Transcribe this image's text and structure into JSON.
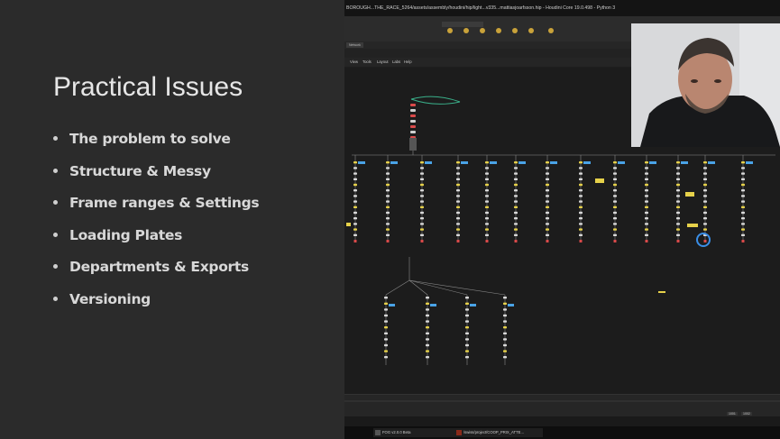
{
  "slide": {
    "title": "Practical Issues",
    "bullets": [
      "The problem to solve",
      "Structure & Messy",
      "Frame ranges & Settings",
      "Loading Plates",
      "Departments & Exports",
      "Versioning"
    ]
  },
  "app": {
    "window_title": "BOROUGH...THE_RACE_5264/assets/assembly/houdini/hip/light...v335...mattiasjoarfsson.hip - Houdini Core 19.0.498 - Python 3",
    "pane_tab": "Network",
    "menu": [
      "View",
      "Tools",
      "Layout",
      "Labs",
      "Help"
    ],
    "timeline": {
      "frame_in": "1001",
      "frame_out": "1002"
    },
    "taskbar": [
      {
        "label": "FOG v2.0.0 Beta"
      },
      {
        "label": "/swiss/project/COOP_PRIX_ATTE..."
      }
    ]
  },
  "colors": {
    "slide_bg": "#2b2b2b",
    "slide_text": "#e6e6e6",
    "network_bg": "#1c1c1c",
    "wire": "#8a8a8a",
    "node_yellow": "#e6d14a",
    "node_blue": "#4aa3e6",
    "node_red": "#d94a4a",
    "selection_ring": "#3a8ee6"
  },
  "icons": [
    "bullet-dot",
    "shelf-tool-icon",
    "webcam-person"
  ]
}
